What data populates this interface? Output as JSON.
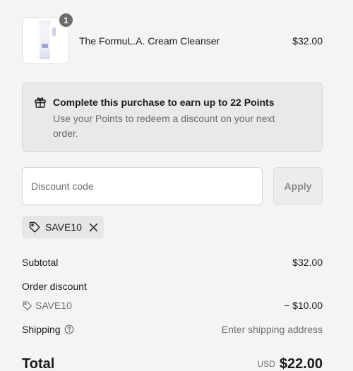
{
  "product": {
    "quantity": "1",
    "name": "The FormuL.A. Cream Cleanser",
    "price": "$32.00"
  },
  "points": {
    "icon": "gift-icon",
    "title": "Complete this purchase to earn up to 22 Points",
    "description": "Use your Points to redeem a discount on your next order."
  },
  "discount": {
    "placeholder": "Discount code",
    "value": "",
    "apply_label": "Apply",
    "applied_code": "SAVE10",
    "remove_icon": "close-icon"
  },
  "summary": {
    "subtotal_label": "Subtotal",
    "subtotal_value": "$32.00",
    "order_discount_label": "Order discount",
    "discount_code": "SAVE10",
    "discount_value": "− $10.00",
    "shipping_label": "Shipping",
    "shipping_value": "Enter shipping address",
    "total_label": "Total",
    "currency": "USD",
    "total_value": "$22.00"
  },
  "colors": {
    "background": "#f4f4f4",
    "banner": "#e9e9e9",
    "muted_text": "#707070",
    "badge": "#6b6b6b"
  }
}
